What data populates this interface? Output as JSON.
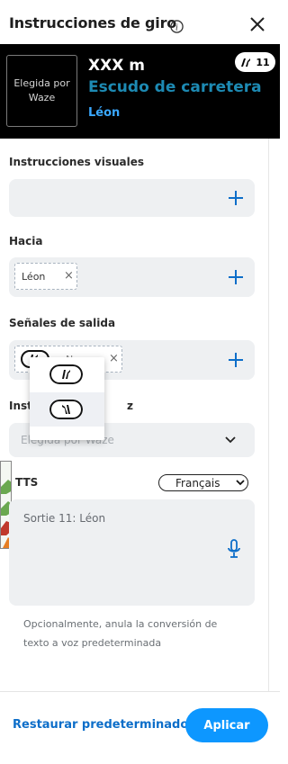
{
  "header": {
    "title": "Instrucciones de giro"
  },
  "banner": {
    "image_placeholder": "Elegida por Waze",
    "distance": "XXX m",
    "road_shield": "Escudo de carretera",
    "towards": "Léon",
    "exit_number": "11"
  },
  "sections": {
    "visual_label": "Instrucciones visuales",
    "towards_label": "Hacia",
    "towards_chip": "Léon",
    "exit_signs_label": "Señales de salida",
    "exit_chip_partial": "N",
    "voice_label_visible": "Instr",
    "voice_label_tail": "z",
    "voice_value": "Elegida por Waze",
    "tts_label": "TTS",
    "tts_language": "Français",
    "tts_text": "Sortie 11: Léon",
    "help_text": "Opcionalmente, anula la conversión de texto a voz predeterminada"
  },
  "footer": {
    "restore_label": "Restaurar predeterminado",
    "apply_label": "Aplicar"
  },
  "colors": {
    "accent": "#0d97ff",
    "link": "#0d6ec9",
    "shield_text": "#1d8ab3",
    "towards_text": "#3aa8ff",
    "field_bg": "#eef0f2"
  }
}
